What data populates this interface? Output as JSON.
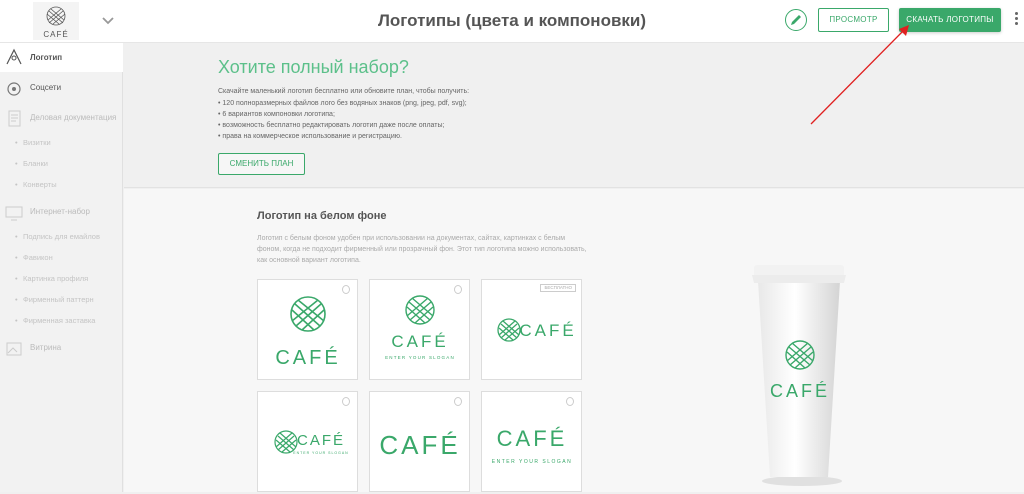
{
  "header": {
    "title": "Логотипы (цвета и компоновки)",
    "preview_label": "ПРОСМОТР",
    "download_label": "СКАЧАТЬ ЛОГОТИПЫ",
    "logo_text": "CAFÉ",
    "accent_color": "#3aa86a"
  },
  "sidebar": {
    "items": [
      {
        "label": "Логотип",
        "icon": "pen-tool-icon",
        "active": true
      },
      {
        "label": "Соцсети",
        "icon": "gear-network-icon"
      },
      {
        "label": "Деловая документация",
        "icon": "document-icon"
      },
      {
        "label": "Интернет-набор",
        "icon": "monitor-icon"
      },
      {
        "label": "Витрина",
        "icon": "image-frame-icon"
      }
    ],
    "docs_sub": [
      "Визитки",
      "Бланки",
      "Конверты"
    ],
    "web_sub": [
      "Подпись для емайлов",
      "Фавикон",
      "Картинка профиля",
      "Фирменный паттерн",
      "Фирменная заставка"
    ]
  },
  "upsell": {
    "title": "Хотите полный набор?",
    "intro": "Скачайте маленький логотип бесплатно или обновите план, чтобы получить:",
    "bullets": [
      "120 полноразмерных файлов лого без водяных знаков (png, jpeg, pdf, svg);",
      "6 вариантов компоновки логотипа;",
      "возможность бесплатно редактировать логотип даже после оплаты;",
      "права на коммерческое использование и регистрацию."
    ],
    "button_label": "СМЕНИТЬ ПЛАН"
  },
  "section": {
    "title": "Логотип на белом фоне",
    "description": "Логотип с белым фоном удобен при использовании на документах, сайтах, картинках с белым фоном, когда не подходит фирменный или прозрачный фон. Этот тип логотипа можно использовать, как основной вариант логотипа.",
    "free_badge": "БЕСПЛАТНО",
    "brand": "CAFÉ",
    "slogan": "ENTER YOUR SLOGAN"
  }
}
